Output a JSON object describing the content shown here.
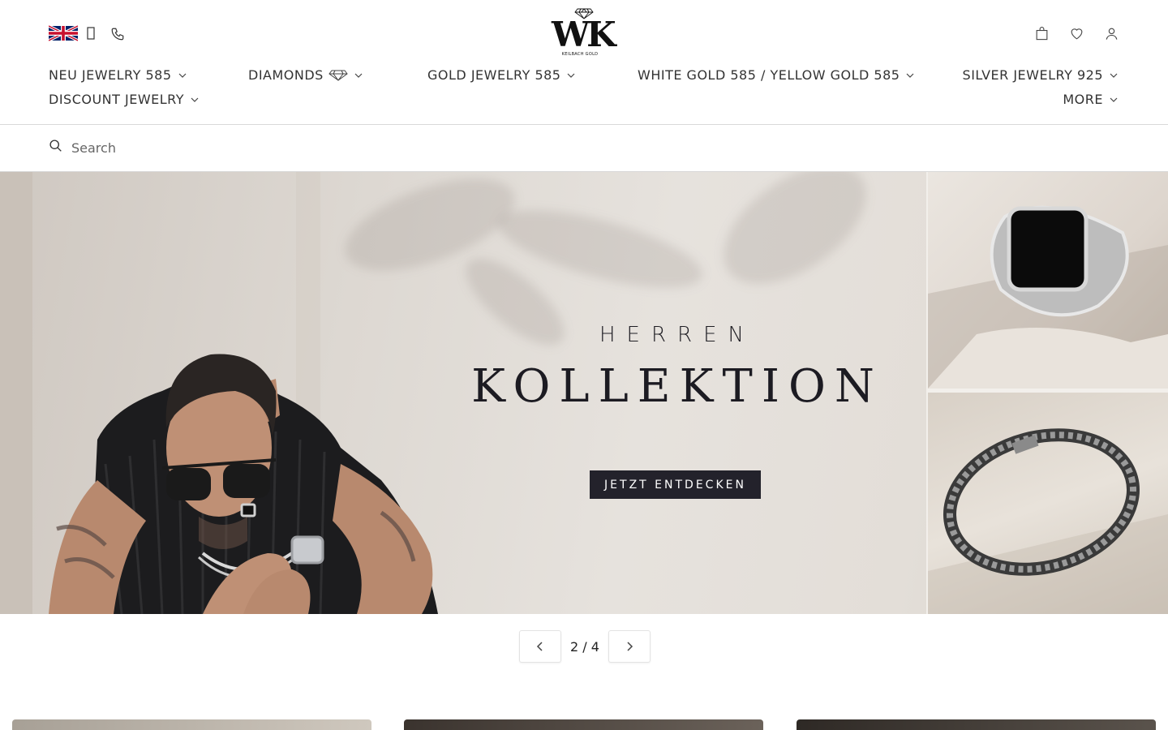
{
  "header": {
    "logo_mark": "WK",
    "logo_subtitle": "KEILBACH GOLD",
    "icons": {
      "language": "uk-flag-icon",
      "phone": "phone-icon",
      "cart": "shopping-bag-icon",
      "wishlist": "heart-icon",
      "account": "user-icon"
    }
  },
  "nav": {
    "items": [
      {
        "label": "NEU JEWELRY 585"
      },
      {
        "label": "DIAMONDS"
      },
      {
        "label": "GOLD JEWELRY 585"
      },
      {
        "label": "WHITE GOLD 585 / YELLOW GOLD 585"
      },
      {
        "label": "SILVER JEWELRY 925"
      },
      {
        "label": "DISCOUNT JEWELRY"
      },
      {
        "label": "MORE"
      }
    ]
  },
  "search": {
    "placeholder": "Search",
    "value": ""
  },
  "hero": {
    "eyebrow": "HERREN",
    "title": "KOLLEKTION",
    "cta_label": "JETZT ENTDECKEN"
  },
  "slider": {
    "counter": "2 / 4",
    "current": 2,
    "total": 4
  },
  "colors": {
    "cta_background": "#23222b",
    "text": "#222222",
    "divider": "#d9d9d9"
  }
}
